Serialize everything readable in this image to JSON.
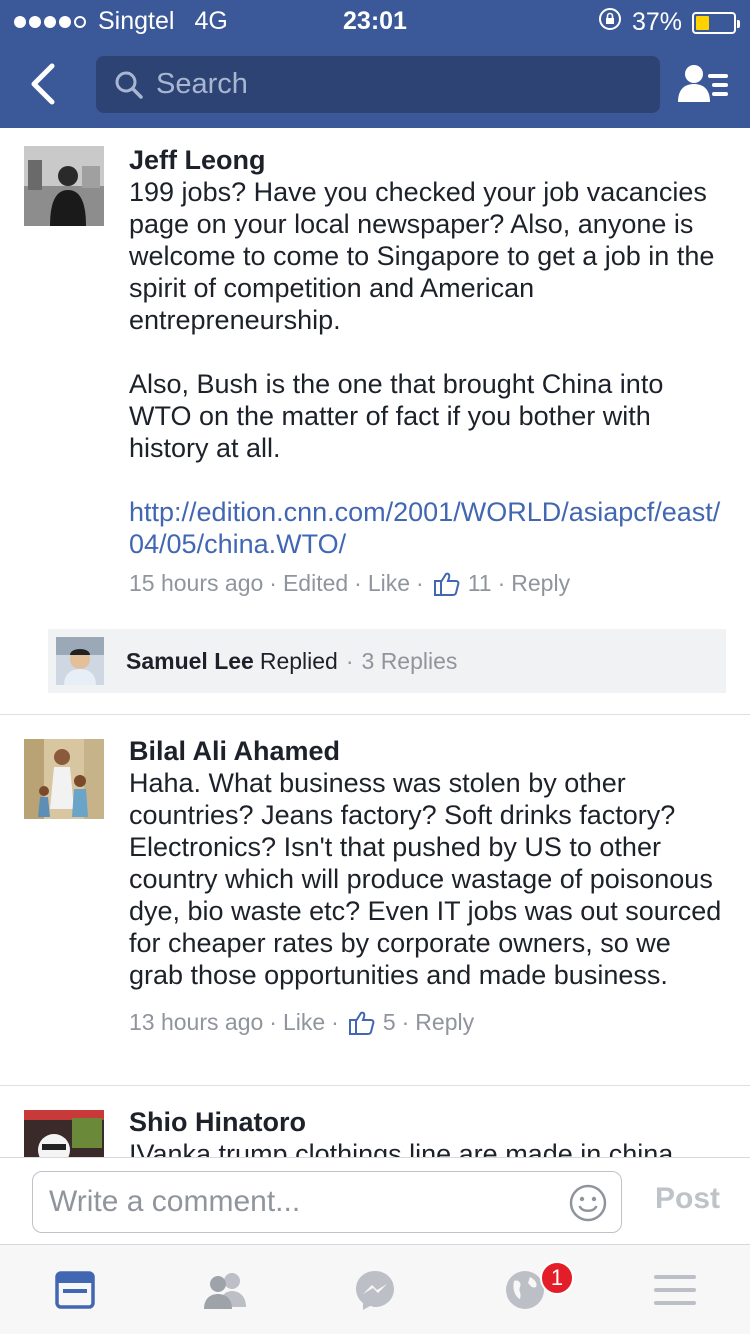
{
  "status_bar": {
    "carrier": "Singtel",
    "network": "4G",
    "time": "23:01",
    "battery_text": "37%",
    "battery_level": 0.37
  },
  "nav": {
    "search_placeholder": "Search",
    "back_icon": "chevron-left-icon",
    "friends_icon": "friend-list-icon"
  },
  "comments": [
    {
      "author": "Jeff Leong",
      "text": "199 jobs? Have you checked your job vacancies page on your local newspaper? Also, anyone is welcome to come to Singapore to get a job in the spirit of competition and American entrepreneurship.\n\nAlso, Bush is the one that brought China into WTO on the matter of fact if you bother with history at all.",
      "link": "http://edition.cnn.com/2001/WORLD/asiapcf/east/04/05/china.WTO/",
      "time": "15 hours ago",
      "edited": "Edited",
      "like": "Like",
      "likes": "11",
      "reply": "Reply",
      "replies": {
        "name": "Samuel Lee",
        "replied": "Replied",
        "count": "3 Replies"
      }
    },
    {
      "author": "Bilal Ali Ahamed",
      "text": "Haha. What business was stolen by other countries? Jeans factory? Soft drinks factory? Electronics? Isn't that pushed by US to other country which will produce wastage of poisonous dye, bio waste etc? Even IT jobs was out sourced for cheaper rates by corporate owners, so we grab those opportunities and made business.",
      "time": "13 hours ago",
      "like": "Like",
      "likes": "5",
      "reply": "Reply"
    },
    {
      "author": "Shio Hinatoro",
      "text": "IVanka trump clothings line are made in china"
    }
  ],
  "composer": {
    "placeholder": "Write a comment...",
    "post_label": "Post"
  },
  "tabbar": {
    "notifications_badge": "1",
    "tabs": [
      "news-feed-icon",
      "friends-icon",
      "messenger-icon",
      "globe-icon",
      "menu-icon"
    ]
  },
  "colors": {
    "brand": "#3b5998",
    "link": "#4267b2",
    "meta": "#90949c",
    "badge": "#e41e28",
    "battery": "#ffd200"
  }
}
